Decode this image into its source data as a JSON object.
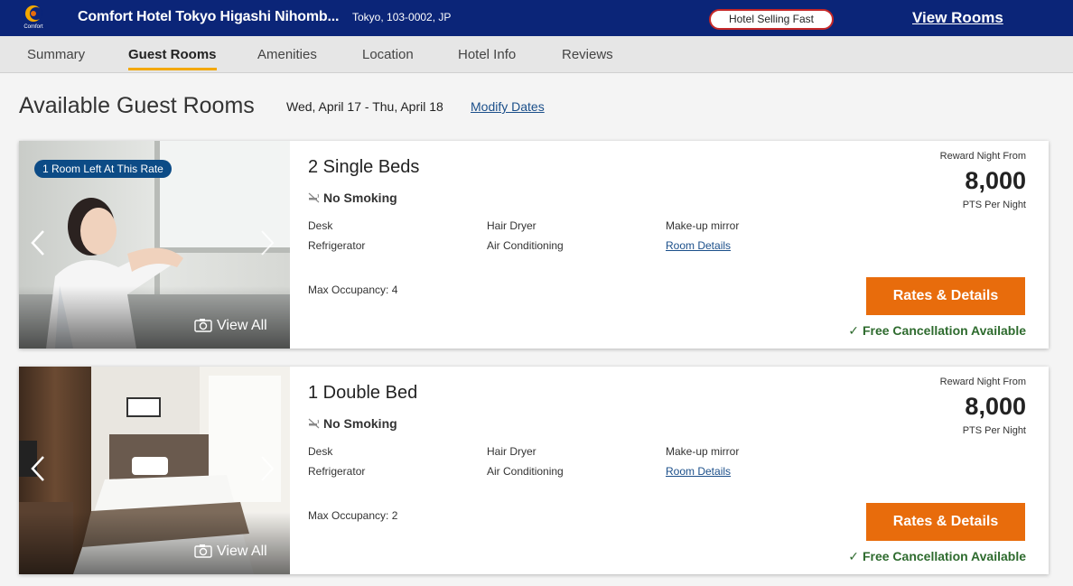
{
  "header": {
    "logo_text": "Comfort",
    "hotel_name": "Comfort Hotel Tokyo Higashi Nihomb...",
    "location": "Tokyo, 103-0002, JP",
    "badge": "Hotel Selling Fast",
    "view_rooms": "View Rooms",
    "brand_color": "#0b2578"
  },
  "tabs": [
    {
      "label": "Summary",
      "active": false
    },
    {
      "label": "Guest Rooms",
      "active": true
    },
    {
      "label": "Amenities",
      "active": false
    },
    {
      "label": "Location",
      "active": false
    },
    {
      "label": "Hotel Info",
      "active": false
    },
    {
      "label": "Reviews",
      "active": false
    }
  ],
  "main": {
    "title": "Available Guest Rooms",
    "dates": "Wed, April 17 - Thu, April 18",
    "modify_dates": "Modify Dates"
  },
  "rooms": [
    {
      "badge": "1 Room Left At This Rate",
      "view_all": "View All",
      "name": "2 Single Beds",
      "smoking": "No Smoking",
      "amenities": [
        "Desk",
        "Hair Dryer",
        "Make-up mirror",
        "Refrigerator",
        "Air Conditioning"
      ],
      "room_details": "Room Details",
      "occupancy": "Max Occupancy: 4",
      "reward_label": "Reward Night From",
      "reward_value": "8,000",
      "reward_unit": "PTS Per Night",
      "button": "Rates & Details",
      "cancellation": "Free Cancellation Available"
    },
    {
      "badge": "",
      "view_all": "View All",
      "name": "1 Double Bed",
      "smoking": "No Smoking",
      "amenities": [
        "Desk",
        "Hair Dryer",
        "Make-up mirror",
        "Refrigerator",
        "Air Conditioning"
      ],
      "room_details": "Room Details",
      "occupancy": "Max Occupancy: 2",
      "reward_label": "Reward Night From",
      "reward_value": "8,000",
      "reward_unit": "PTS Per Night",
      "button": "Rates & Details",
      "cancellation": "Free Cancellation Available"
    }
  ],
  "colors": {
    "accent_orange": "#e86c0c",
    "tab_underline": "#f3a800",
    "badge_blue": "#0c4b86",
    "link_blue": "#1b4f8a",
    "cancel_green": "#2e6b2e",
    "selling_border": "#c62828"
  },
  "icons": [
    "comfort-logo",
    "no-smoking-icon",
    "camera-icon",
    "chevron-left-icon",
    "chevron-right-icon",
    "checkmark-icon"
  ]
}
